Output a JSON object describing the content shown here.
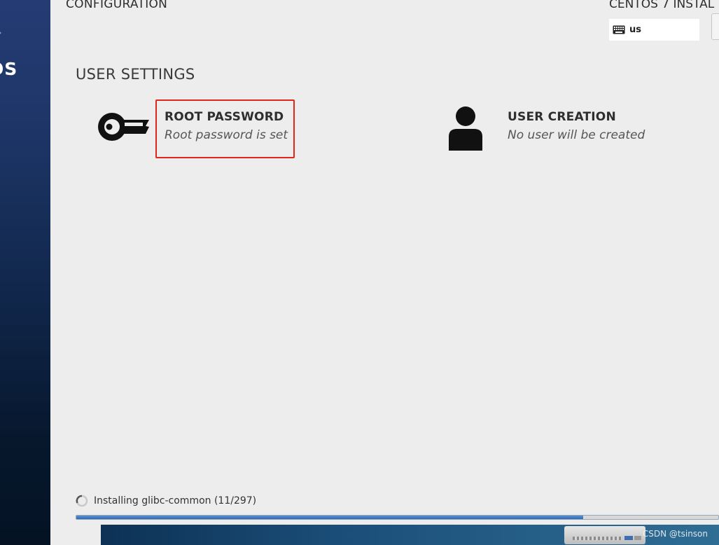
{
  "header": {
    "spoke_title": "CONFIGURATION",
    "product_title": "CENTOS 7 INSTAL",
    "keyboard_layout": "us"
  },
  "sidebar": {
    "logo_text": "OS"
  },
  "user_settings": {
    "title": "USER SETTINGS",
    "root_password": {
      "name": "ROOT PASSWORD",
      "status": "Root password is set",
      "icon": "key-icon"
    },
    "user_creation": {
      "name": "USER CREATION",
      "status": "No user will be created",
      "icon": "user-icon"
    }
  },
  "progress": {
    "label": "Installing glibc-common (11/297)",
    "fraction": 0.79
  },
  "watermark": "CSDN @tsinson",
  "colors": {
    "highlight": "#e3261c",
    "sidebar": "#1d3566",
    "progress_fill": "#2f6ab5"
  }
}
